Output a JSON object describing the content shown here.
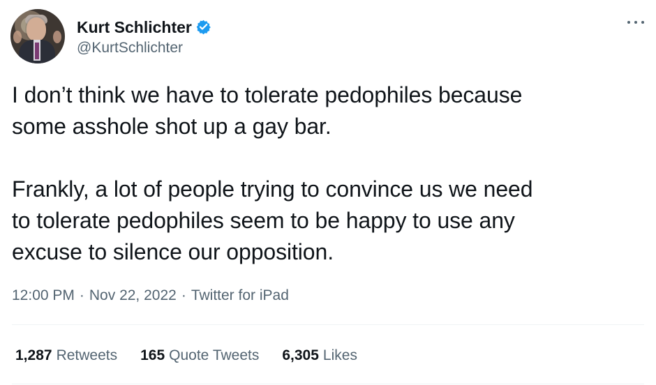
{
  "author": {
    "display_name": "Kurt Schlichter",
    "handle": "@KurtSchlichter",
    "verified": true,
    "avatar_icon": "profile-photo"
  },
  "actions": {
    "more_icon": "more-horizontal-icon"
  },
  "tweet": {
    "text": "I don’t think we have to tolerate pedophiles because\nsome asshole shot up a gay bar.\n\nFrankly, a lot of people trying to convince us we need\nto tolerate pedophiles seem to be happy to use any\nexcuse to silence our opposition.",
    "time": "12:00 PM",
    "separator_1": "·",
    "date": "Nov 22, 2022",
    "separator_2": "·",
    "source": "Twitter for iPad"
  },
  "stats": [
    {
      "count": "1,287",
      "label": "Retweets"
    },
    {
      "count": "165",
      "label": "Quote Tweets"
    },
    {
      "count": "6,305",
      "label": "Likes"
    }
  ],
  "colors": {
    "primary_text": "#0f1419",
    "secondary_text": "#536471",
    "divider": "#eff3f4",
    "verified_blue": "#1d9bf0"
  }
}
